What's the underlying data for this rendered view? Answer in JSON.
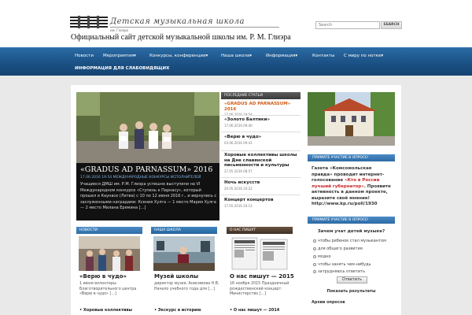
{
  "header": {
    "logo_script": "Детская музыкальная школа",
    "logo_subtitle": "им. Глиэра",
    "site_title": "Официальный сайт детской музыкальной школы им. Р. М. Глиэра",
    "search_placeholder": "Search",
    "search_button": "SEARCH"
  },
  "nav": {
    "items": [
      "Новости",
      "Мероприятия",
      "Конкурсы, конференции",
      "Наша школа",
      "Информация",
      "Контакты",
      "С миру по нотке"
    ],
    "item2": "ИНФОРМАЦИЯ ДЛЯ СЛАБОВИДЯЩИХ",
    "dropdown_arrow": "▾"
  },
  "featured": {
    "title": "«GRADUS AD PARNASSUM» 2016",
    "date": "17.06.2016 19:54",
    "category": "МЕЖДУНАРОДНЫЕ КОНКУРСЫ ИСПОЛНИТЕЛЕЙ",
    "text": "Учащиеся ДМШ им. Р.М. Глиэра успешно выступили на VI Международном конкурсе «Ступень к Парнасу», который прошел в Каунасе (Литва) с 10 по 12 июня 2016 г., и вернулись с заслуженными наградами: Ксения Хулга — 1 место Мария Хулга — 2 место Милана Еремина [...]"
  },
  "latest": {
    "heading": "ПОСЛЕДНИЕ СТАТЬИ",
    "items": [
      {
        "title": "«GRADUS AD PARNASSUM» 2016",
        "date": "17.06.2016 19:54"
      },
      {
        "title": "«Золото Балтики»",
        "date": "17.06.2016 09:46"
      },
      {
        "title": "«Верю в чудо»",
        "date": "03.06.2016 09:41"
      },
      {
        "title": "Хоровые коллективы школы на Дне славянской письменности и культуры",
        "date": "27.05.2016 08:57"
      },
      {
        "title": "Ночь искусств",
        "date": "20.05.2016 20:22"
      },
      {
        "title": "Концерт концертов",
        "date": "17.05.2016 20:13"
      }
    ]
  },
  "sidebar": {
    "vote_heading": "ПРИМИТЕ УЧАСТИЕ В ОПРОСЕ!",
    "vote_text_1": "Газета «Комсомольская правда» проводит интернет-голосование ",
    "vote_text_red": "«Кто в России лучший губернатор»",
    "vote_text_2": ". Проявите активность в данном проекте, выразите своё мнение! ",
    "vote_link": "http://www.kp.ru/poll/1930",
    "poll_heading": "ПРИМИТЕ УЧАСТИЕ В ОПРОСЕ!",
    "poll_question": "Зачем учат детей музыке?",
    "poll_options": [
      "чтобы ребенок стал музыкантом",
      "для общего развития",
      "модно",
      "чтобы занять чем-нибудь",
      "затрудняюсь ответить"
    ],
    "poll_button": "Ответить",
    "poll_results": "Показать результаты",
    "poll_archive": "Архив опросов"
  },
  "columns": [
    {
      "heading": "НОВОСТИ",
      "title": "«Верю в чудо»",
      "text": "1 июня волонтеры Благотворительного центра «Верю в чудо» [...]",
      "bullet": "• Хоровые коллективы"
    },
    {
      "heading": "НАША ШКОЛА",
      "title": "Музей школы",
      "text": "директор музея, Анисимова Н.В. Начало учебного года для [...]",
      "bullet": "• Экскурс в историю"
    },
    {
      "heading": "О НАС ПИШУТ",
      "title": "О нас пишут — 2015",
      "text": "16 ноября 2015 Праздничный рождественский концерт. Министерство [...]",
      "bullet": "• О нас пишут — 2014"
    }
  ],
  "colors": {
    "nav_blue": "#1a4f82",
    "accent_orange": "#d05a14",
    "col_news": "#3b77b0",
    "col_school": "#2a6fa8",
    "col_press": "#4a3a2c"
  }
}
